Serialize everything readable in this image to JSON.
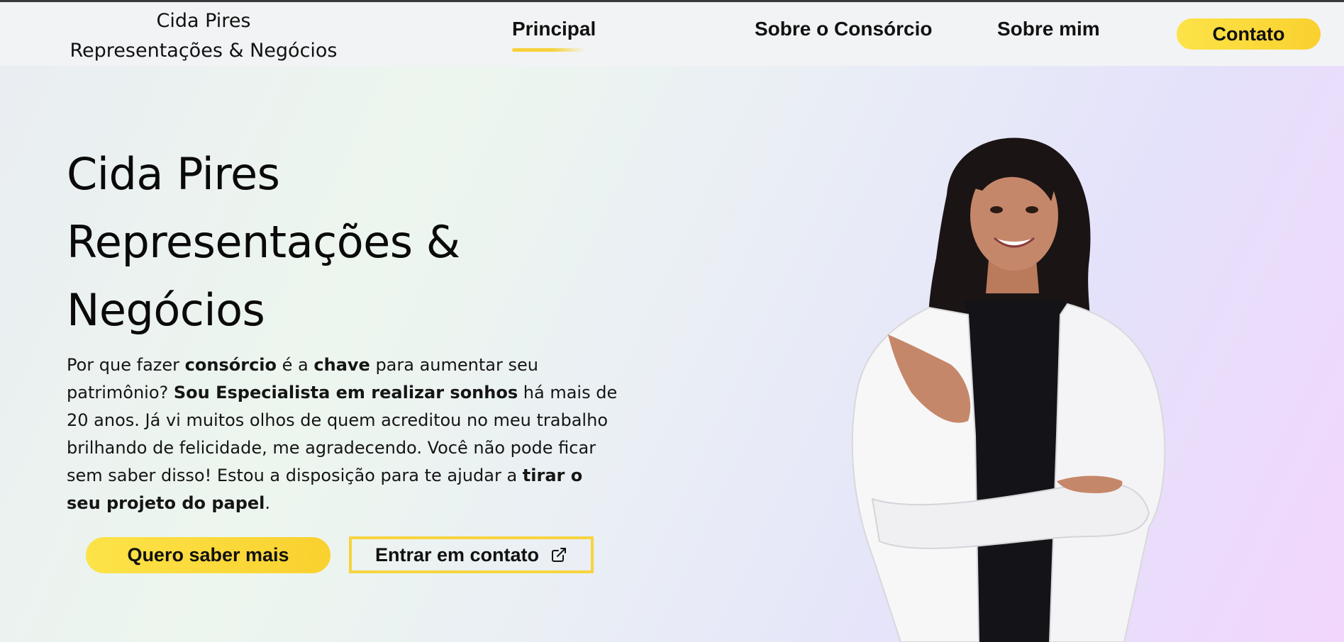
{
  "header": {
    "brand_line1": "Cida Pires",
    "brand_line2": "Representações & Negócios",
    "nav": [
      {
        "label": "Principal",
        "active": true
      },
      {
        "label": "Sobre o Consórcio",
        "active": false
      },
      {
        "label": "Sobre mim",
        "active": false
      }
    ],
    "contact_label": "Contato"
  },
  "hero": {
    "title_line1": "Cida Pires",
    "title_line2": "Representações &",
    "title_line3": "Negócios",
    "text": {
      "p1": "Por que fazer ",
      "b1": "consórcio",
      "p2": " é a ",
      "b2": "chave",
      "p3": " para aumentar seu patrimônio? ",
      "b3": "Sou Especialista em realizar sonhos",
      "p4": " há mais de 20 anos. Já vi muitos olhos de quem acreditou no meu trabalho brilhando de felicidade, me agradecendo. Você não pode ficar sem saber disso! Estou a disposição para te ajudar a ",
      "b4": "tirar o seu projeto do papel",
      "p5": "."
    },
    "primary_button": "Quero saber mais",
    "secondary_button": "Entrar em contato",
    "secondary_icon": "external-link-icon"
  },
  "colors": {
    "accent": "#f9d12f",
    "text": "#0c0c0c",
    "header_bg": "#f2f3f5"
  }
}
